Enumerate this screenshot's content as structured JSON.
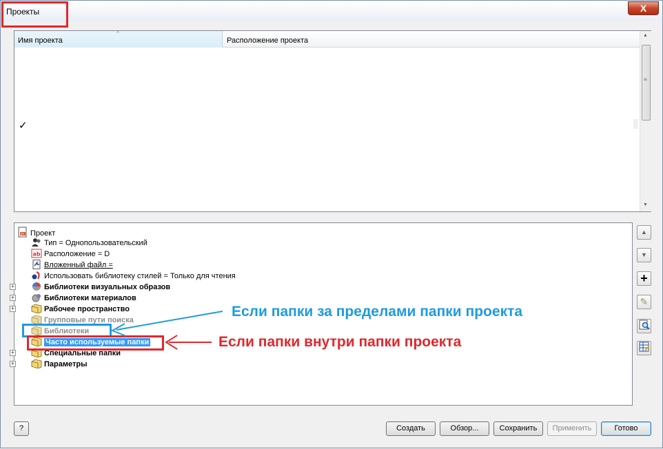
{
  "window": {
    "title": "Проекты",
    "close_label": "X"
  },
  "project_list": {
    "columns": [
      "Имя проекта",
      "Расположение проекта"
    ],
    "sort_indicator": "^",
    "active_marker": "✓",
    "scrollbar": {
      "up": "▲",
      "down": "▼",
      "grip": "≡"
    }
  },
  "tree": {
    "root": "Проект",
    "items": [
      {
        "label": "Тип = Однопользовательский",
        "icon": "user-type-icon"
      },
      {
        "label": "Расположение = D",
        "icon": "ab-location-icon"
      },
      {
        "label": "Вложенный файл =",
        "icon": "included-file-icon",
        "style": "underline"
      },
      {
        "label": "Использовать библиотеку стилей = Только для чтения",
        "icon": "style-library-icon"
      },
      {
        "label": "Библиотеки визуальных образов",
        "icon": "appearance-library-icon",
        "style": "bold",
        "expandable": true
      },
      {
        "label": "Библиотеки материалов",
        "icon": "material-library-icon",
        "style": "bold",
        "expandable": true
      },
      {
        "label": "Рабочее пространство",
        "icon": "folder-icon",
        "style": "bold",
        "expandable": true
      },
      {
        "label": "Групповые пути поиска",
        "icon": "folder-icon",
        "style": "gray"
      },
      {
        "label": "Библиотеки",
        "icon": "folder-icon",
        "style": "gray"
      },
      {
        "label": "Часто используемые папки",
        "icon": "folder-icon",
        "style": "selected"
      },
      {
        "label": "Специальные папки",
        "icon": "folder-icon",
        "style": "bold",
        "expandable": true
      },
      {
        "label": "Параметры",
        "icon": "folder-icon",
        "style": "bold",
        "expandable": true
      }
    ],
    "expander_symbol": "+"
  },
  "side_buttons": {
    "up": "▲",
    "down": "▼",
    "add": "+",
    "edit": "✎",
    "find": "🔍",
    "extra": "▦"
  },
  "buttons": {
    "help": "?",
    "create": "Создать",
    "browse": "Обзор...",
    "save": "Сохранить",
    "apply": "Применить",
    "done": "Готово"
  },
  "annotations": {
    "outside": "Если папки за пределами папки проекта",
    "inside": "Если папки внутри папки проекта"
  },
  "colors": {
    "annotation_blue": "#1e9be0",
    "annotation_red": "#e3262b",
    "selection": "#3399ff"
  }
}
